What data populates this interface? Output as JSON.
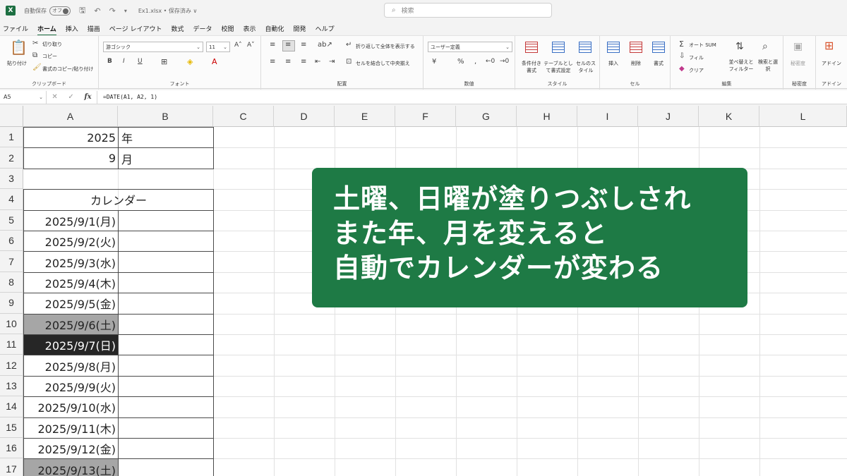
{
  "titlebar": {
    "autosave_label": "自動保存",
    "toggle_label": "オフ",
    "filename": "Ex1.xlsx • 保存済み ∨",
    "search_placeholder": "検索"
  },
  "menu": [
    "ファイル",
    "ホーム",
    "挿入",
    "描画",
    "ページ レイアウト",
    "数式",
    "データ",
    "校閲",
    "表示",
    "自動化",
    "開発",
    "ヘルプ"
  ],
  "menu_active": "ホーム",
  "ribbon": {
    "clipboard": {
      "paste": "貼り付け",
      "cut": "切り取り",
      "copy": "コピー",
      "format_painter": "書式のコピー/貼り付け",
      "label": "クリップボード"
    },
    "font": {
      "font_name": "游ゴシック",
      "font_size": "11",
      "bold": "B",
      "italic": "I",
      "underline": "U",
      "label": "フォント"
    },
    "alignment": {
      "wrap": "折り返して全体を表示する",
      "merge": "セルを結合して中央揃え",
      "label": "配置"
    },
    "number": {
      "format": "ユーザー定義",
      "label": "数値"
    },
    "styles": {
      "cond": "条件付き書式",
      "table": "テーブルとして書式設定",
      "cell": "セルのスタイル",
      "label": "スタイル"
    },
    "cells": {
      "insert": "挿入",
      "delete": "削除",
      "format": "書式",
      "label": "セル"
    },
    "editing": {
      "autosum": "オート SUM",
      "fill": "フィル",
      "clear": "クリア",
      "sort": "並べ替えとフィルター",
      "find": "検索と選択",
      "label": "編集"
    },
    "sensitivity": {
      "btn": "秘密度",
      "label": "秘密度"
    },
    "addin": {
      "btn": "アドイン",
      "label": "アドイン"
    }
  },
  "formula_bar": {
    "name_box": "A5",
    "formula": "=DATE(A1, A2, 1)"
  },
  "columns": [
    "A",
    "B",
    "C",
    "D",
    "E",
    "F",
    "G",
    "H",
    "I",
    "J",
    "K",
    "L"
  ],
  "rows": [
    "1",
    "2",
    "3",
    "4",
    "5",
    "6",
    "7",
    "8",
    "9",
    "10",
    "11",
    "12",
    "13",
    "14",
    "15",
    "16",
    "17"
  ],
  "cells": {
    "a1": "2025",
    "b1": "年",
    "a2": "9",
    "b2": "月",
    "a4": "カレンダー",
    "dates": [
      "2025/9/1(月)",
      "2025/9/2(火)",
      "2025/9/3(水)",
      "2025/9/4(木)",
      "2025/9/5(金)",
      "2025/9/6(土)",
      "2025/9/7(日)",
      "2025/9/8(月)",
      "2025/9/9(火)",
      "2025/9/10(水)",
      "2025/9/11(木)",
      "2025/9/12(金)",
      "2025/9/13(土)"
    ]
  },
  "fill_colors": {
    "saturday": "#a6a6a6",
    "sunday": "#262626",
    "brand": "#1d6f42",
    "callout": "#1e7a45"
  },
  "callout": {
    "line1": "土曜、日曜が塗りつぶしされ",
    "line2": "また年、月を変えると",
    "line3": "自動でカレンダーが変わる"
  }
}
